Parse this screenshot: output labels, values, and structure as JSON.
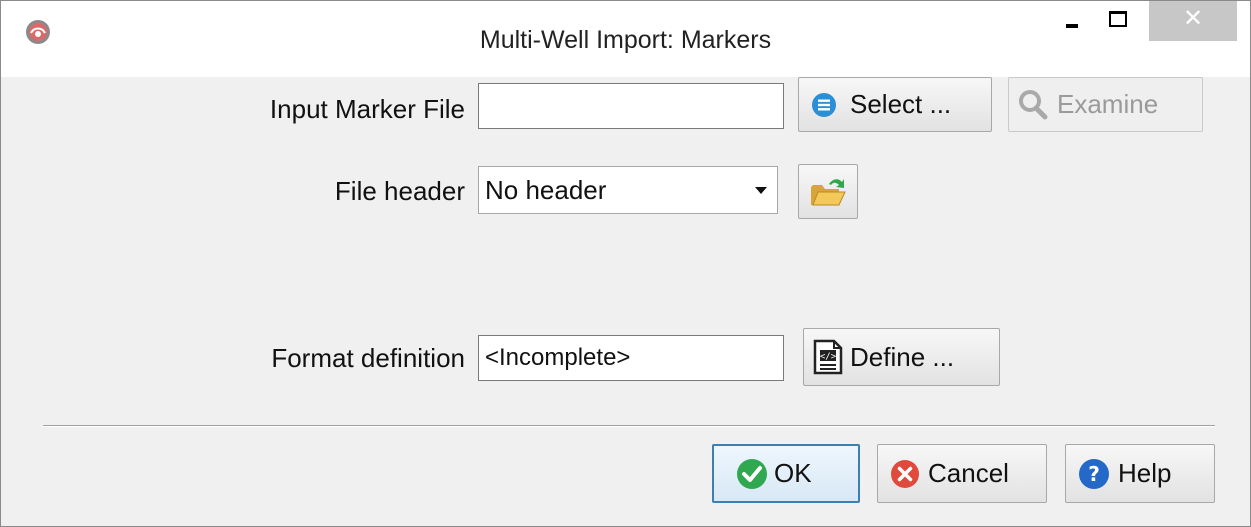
{
  "window": {
    "title": "Multi-Well Import: Markers",
    "icon": "app-logo-icon",
    "controls": {
      "minimize": "minimize-icon",
      "maximize": "maximize-icon",
      "close": "close-icon",
      "close_glyph": "✕"
    }
  },
  "input_file": {
    "label": "Input Marker File",
    "value": "",
    "select_label": "Select ...",
    "examine_label": "Examine"
  },
  "file_header": {
    "label": "File header",
    "selected": "No header"
  },
  "format": {
    "label": "Format definition",
    "value": "<Incomplete>",
    "define_label": "Define ..."
  },
  "footer": {
    "ok_label": "OK",
    "cancel_label": "Cancel",
    "help_label": "Help"
  },
  "colors": {
    "select_icon": "#2a8fd6",
    "ok_icon": "#2fa84f",
    "cancel_icon": "#e04a3c",
    "help_icon": "#2468c8",
    "default_button_border": "#3c7fb1"
  }
}
